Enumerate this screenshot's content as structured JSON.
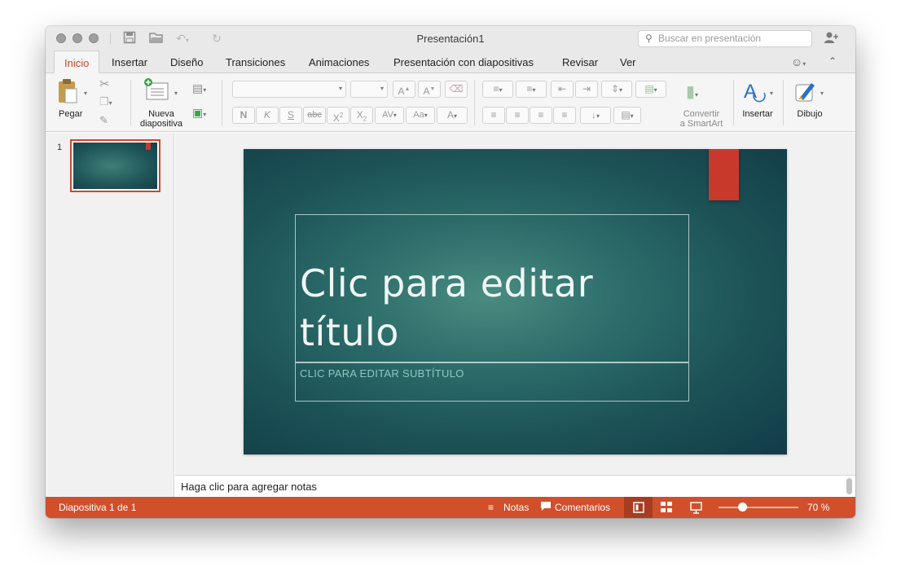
{
  "window": {
    "title": "Presentación1"
  },
  "search": {
    "placeholder": "Buscar en presentación"
  },
  "tabs": [
    {
      "label": "Inicio",
      "active": true
    },
    {
      "label": "Insertar"
    },
    {
      "label": "Diseño"
    },
    {
      "label": "Transiciones"
    },
    {
      "label": "Animaciones"
    },
    {
      "label": "Presentación con diapositivas"
    },
    {
      "label": "Revisar"
    },
    {
      "label": "Ver"
    }
  ],
  "ribbon": {
    "paste_label": "Pegar",
    "new_slide_label_1": "Nueva",
    "new_slide_label_2": "diapositiva",
    "font_bold": "N",
    "font_italic": "K",
    "font_underline": "S",
    "font_strike": "abc",
    "smartart_label_1": "Convertir",
    "smartart_label_2": "a SmartArt",
    "insert_label": "Insertar",
    "draw_label": "Dibujo"
  },
  "thumbnails": [
    {
      "number": "1"
    }
  ],
  "slide": {
    "title_placeholder": "Clic para editar título",
    "subtitle_placeholder": "CLIC PARA EDITAR SUBTÍTULO"
  },
  "notes": {
    "placeholder": "Haga clic para agregar notas"
  },
  "status": {
    "slide_counter": "Diapositiva 1 de 1",
    "notes_label": "Notas",
    "comments_label": "Comentarios",
    "zoom": "70 %",
    "zoom_fraction": 0.3
  },
  "colors": {
    "accent": "#d24f2c",
    "slide_bg": "#1d5458",
    "slide_flag": "#c9392b"
  },
  "icons": [
    "save-icon",
    "open-icon",
    "undo-icon",
    "redo-icon",
    "search-icon",
    "share-icon",
    "smiley-icon",
    "collapse-ribbon-icon",
    "cut-icon",
    "copy-icon",
    "format-painter-icon",
    "layout-icon",
    "section-icon",
    "bullets-icon",
    "numbering-icon",
    "shapes-icon",
    "notes-icon",
    "comments-icon",
    "normal-view-icon",
    "sorter-view-icon",
    "slideshow-icon"
  ]
}
